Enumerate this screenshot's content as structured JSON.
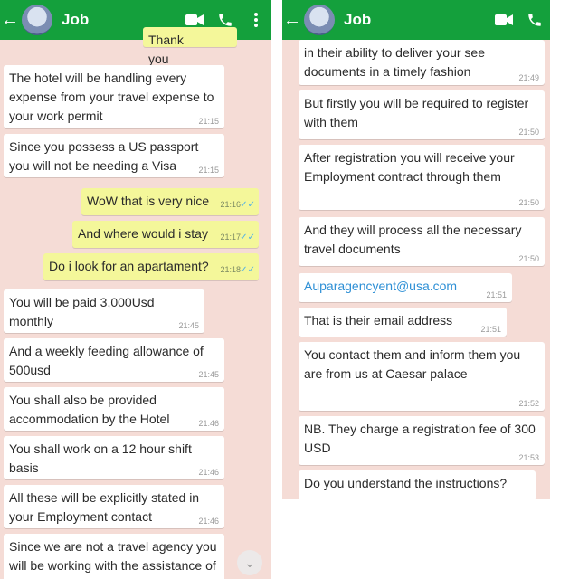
{
  "left": {
    "contact_name": "Job",
    "messages": [
      {
        "text": "Thank you",
        "time": ""
      },
      {
        "text": "The hotel will be handling every expense from your travel expense to your work permit",
        "time": "21:15"
      },
      {
        "text": "Since you possess a US passport you will not be needing a Visa",
        "time": "21:15"
      },
      {
        "text": "WoW that is very nice",
        "time": "21:16"
      },
      {
        "text": "And where would i stay",
        "time": "21:17"
      },
      {
        "text": "Do i look for an apartament?",
        "time": "21:18"
      },
      {
        "text": "You will be paid 3,000Usd monthly",
        "time": "21:45"
      },
      {
        "text": "And a weekly feeding allowance of 500usd",
        "time": "21:45"
      },
      {
        "text": "You shall also be provided accommodation by the Hotel",
        "time": "21:46"
      },
      {
        "text": "You shall work on a 12 hour shift basis",
        "time": "21:46"
      },
      {
        "text": "All these will be explicitly stated in your Employment contact",
        "time": "21:46"
      },
      {
        "text": "Since we are not a travel agency you will be working with the assistance of",
        "time": ""
      }
    ]
  },
  "right": {
    "contact_name": "Job",
    "messages": [
      {
        "text": "in their ability to deliver your see documents in a timely fashion",
        "time": "21:49"
      },
      {
        "text": "But firstly you will be required to register with them",
        "time": "21:50"
      },
      {
        "text": "After registration you will receive your Employment contract through them",
        "time": "21:50"
      },
      {
        "text": "And they will process all the necessary travel documents",
        "time": "21:50"
      },
      {
        "text": "Auparagencyent@usa.com",
        "time": "21:51"
      },
      {
        "text": "That is their email address",
        "time": "21:51"
      },
      {
        "text": "You contact them and inform them you are from us at Caesar palace",
        "time": "21:52"
      },
      {
        "text": "NB. They charge a registration fee of 300 USD",
        "time": "21:53"
      },
      {
        "text": "Do you understand the instructions?",
        "time": ""
      }
    ]
  },
  "colors": {
    "header": "#14a03c",
    "chat_bg": "#f5dcd6",
    "incoming": "#ffffff",
    "outgoing": "#dcf8b6",
    "highlight": "#f4f79a",
    "link": "#2d8fd5",
    "read_ticks": "#4fb0e8"
  },
  "icons": [
    "back-arrow-icon",
    "avatar",
    "video-call-icon",
    "phone-icon",
    "more-vert-icon",
    "scroll-down-icon",
    "double-check-icon"
  ]
}
